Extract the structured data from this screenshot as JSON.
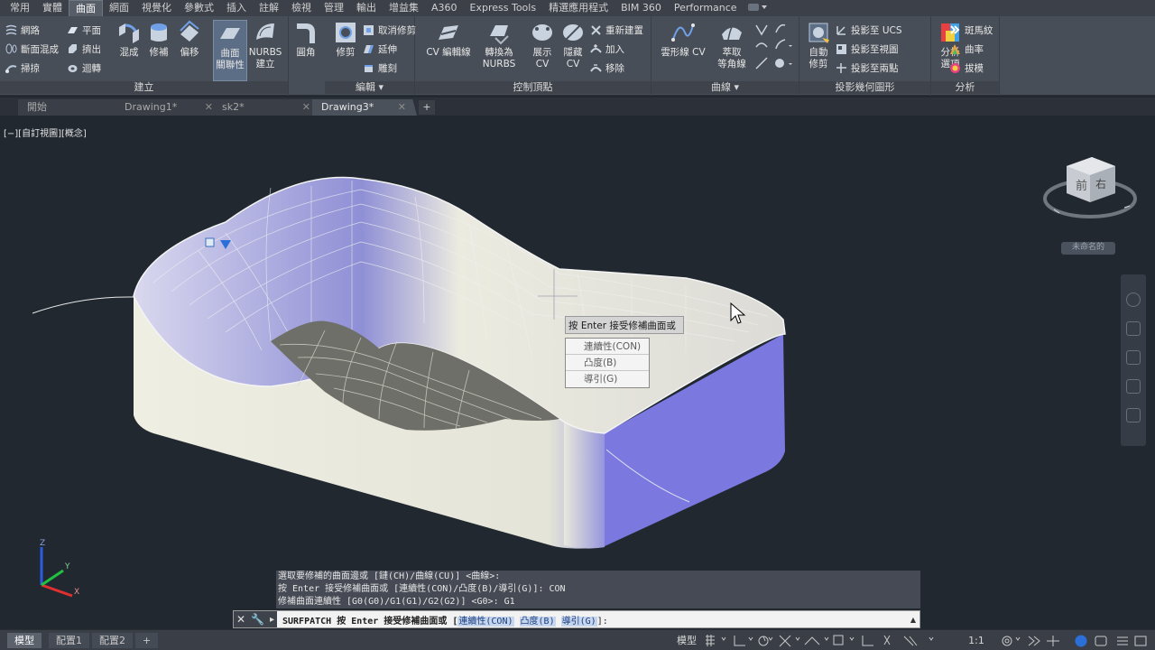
{
  "ribbon": {
    "tabs": [
      "常用",
      "實體",
      "曲面",
      "網面",
      "視覺化",
      "參數式",
      "插入",
      "註解",
      "檢視",
      "管理",
      "輸出",
      "增益集",
      "A360",
      "Express Tools",
      "精選應用程式",
      "BIM 360",
      "Performance"
    ],
    "active_tab": "曲面",
    "groups": {
      "create": {
        "label": "建立",
        "small": [
          "網路",
          "斷面混成",
          "掃掠",
          "平面",
          "擠出",
          "迴轉"
        ],
        "big": [
          "混成",
          "修補",
          "偏移",
          "曲面\n關聯性",
          "NURBS\n建立",
          "圓角"
        ]
      },
      "edit": {
        "label": "編輯",
        "big": [
          "修剪"
        ],
        "small": [
          "取消修剪",
          "延伸",
          "雕刻"
        ]
      },
      "control_vertices": {
        "label": "控制頂點",
        "big": [
          "CV 編輯線",
          "轉換為\nNURBS",
          "展示\nCV",
          "隱藏\nCV"
        ],
        "small": [
          "重新建置",
          "加入",
          "移除"
        ]
      },
      "curves": {
        "label": "曲線",
        "big": [
          "雲形線 CV",
          "萃取\n等角線"
        ]
      },
      "project": {
        "label": "投影幾何圖形",
        "big": [
          "自動\n修剪"
        ],
        "small": [
          "投影至 UCS",
          "投影至視圖",
          "投影至兩點"
        ]
      },
      "analysis": {
        "label": "分析",
        "big": [
          "分析\n選項"
        ],
        "small": [
          "斑馬紋",
          "曲率",
          "拔模"
        ]
      }
    }
  },
  "doc_tabs": [
    {
      "label": "開始",
      "active": false
    },
    {
      "label": "Drawing1*",
      "active": false
    },
    {
      "label": "sk2*",
      "active": false
    },
    {
      "label": "Drawing3*",
      "active": true
    }
  ],
  "viewport": {
    "label": "[−][自訂視圖][概念]",
    "viewcube_front": "前",
    "viewcube_right": "右",
    "wcs_label": "未命名的",
    "tooltip_title": "按 Enter 接受修補曲面或",
    "tooltip_options": [
      "連續性(CON)",
      "凸度(B)",
      "導引(G)"
    ],
    "ucs_axes": [
      "X",
      "Y",
      "Z"
    ]
  },
  "command": {
    "history": [
      "選取要修補的曲面邊或 [鏈(CH)/曲線(CU)] <曲線>:",
      "按 Enter 接受修補曲面或 [連續性(CON)/凸度(B)/導引(G)]: CON",
      "修補曲面連續性 [G0(G0)/G1(G1)/G2(G2)] <G0>: G1"
    ],
    "prompt_prefix": "SURFPATCH 按 Enter 接受修補曲面或 [",
    "options": [
      "連續性(CON)",
      "凸度(B)",
      "導引(G)"
    ],
    "prompt_suffix": "]:"
  },
  "status_bar": {
    "layout_tabs": [
      "模型",
      "配置1",
      "配置2"
    ],
    "model_label": "模型",
    "scale": "1:1"
  }
}
